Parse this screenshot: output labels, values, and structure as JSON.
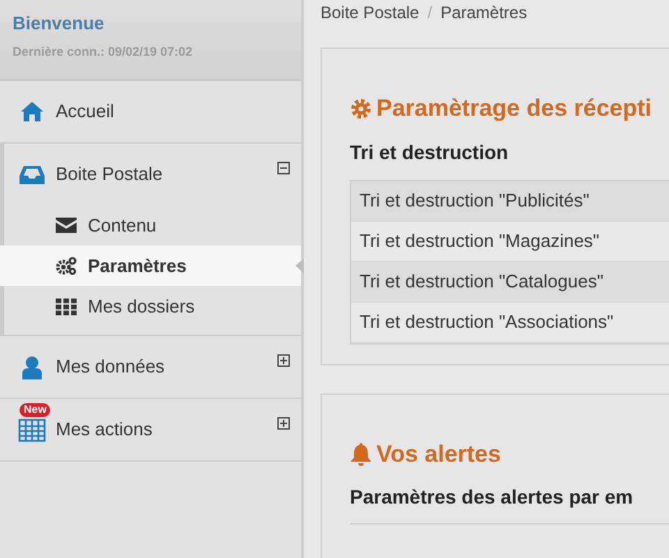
{
  "sidebar": {
    "welcome": "Bienvenue",
    "last_login": "Dernière conn.: 09/02/19 07:02",
    "items": [
      {
        "kind": "home",
        "label": "Accueil"
      },
      {
        "kind": "inbox",
        "label": "Boite Postale",
        "expanded": true,
        "children": [
          {
            "kind": "envelope",
            "label": "Contenu",
            "selected": false
          },
          {
            "kind": "gears",
            "label": "Paramètres",
            "selected": true
          },
          {
            "kind": "grid",
            "label": "Mes dossiers",
            "selected": false
          }
        ]
      },
      {
        "kind": "user",
        "label": "Mes données",
        "expanded": false
      },
      {
        "kind": "calendar",
        "label": "Mes actions",
        "expanded": false,
        "badge": "New"
      }
    ]
  },
  "breadcrumb": {
    "items": [
      "Boite Postale",
      "Paramètres"
    ],
    "separator": "/"
  },
  "panels": [
    {
      "kind": "gear",
      "title": "Paramètrage des récepti",
      "subtitle": "Tri et destruction",
      "rows": [
        "Tri et destruction \"Publicités\"",
        "Tri et destruction \"Magazines\"",
        "Tri et destruction \"Catalogues\"",
        "Tri et destruction \"Associations\""
      ]
    },
    {
      "kind": "bell",
      "title": "Vos alertes",
      "subtitle": "Paramètres des alertes par em"
    }
  ]
}
